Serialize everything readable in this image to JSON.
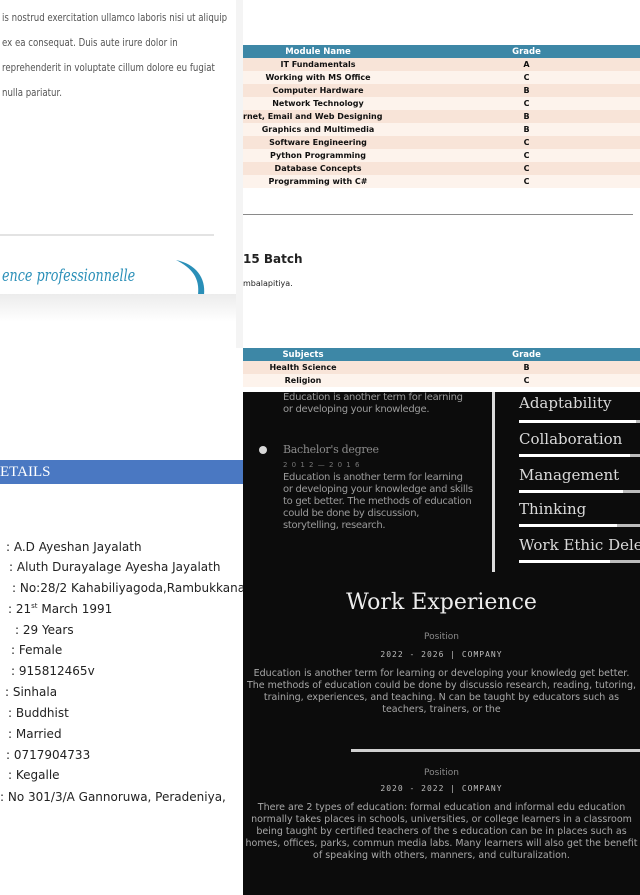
{
  "letter": {
    "paragraph": "is nostrud exercitation ullamco laboris nisi ut aliquip ex ea consequat. Duis aute irure dolor in reprehenderit in voluptate cillum dolore eu fugiat nulla pariatur.",
    "footer": "ence professionnelle"
  },
  "results_top": {
    "headers": [
      "Module Name",
      "Grade"
    ],
    "rows": [
      [
        "IT Fundamentals",
        "A"
      ],
      [
        "Working with MS Office",
        "C"
      ],
      [
        "Computer Hardware",
        "B"
      ],
      [
        "Network Technology",
        "C"
      ],
      [
        "rnet, Email and Web Designing",
        "B"
      ],
      [
        "Graphics and Multimedia",
        "B"
      ],
      [
        "Software Engineering",
        "C"
      ],
      [
        "Python Programming",
        "C"
      ],
      [
        "Database Concepts",
        "C"
      ],
      [
        "Programming with C#",
        "C"
      ]
    ],
    "batch": "15 Batch",
    "place": "mbalapitiya."
  },
  "results_bottom": {
    "headers": [
      "Subjects",
      "Grade"
    ],
    "rows": [
      [
        "Health Science",
        "B"
      ],
      [
        "Religion",
        "C"
      ]
    ]
  },
  "details": {
    "header": "ETAILS",
    "items": [
      ": A.D Ayeshan Jayalath",
      ": Aluth Durayalage Ayesha Jayalath",
      ": No:28/2 Kahabiliyagoda,Rambukkana",
      ": 21",
      ": 29 Years",
      ": Female",
      ": 915812465v",
      ": Sinhala",
      ": Buddhist",
      ": Married",
      ": 0717904733",
      ": Kegalle",
      ": No 301/3/A Gannoruwa, Peradeniya,"
    ],
    "dob_sup": "st",
    "dob_rest": " March 1991"
  },
  "cv": {
    "edu_top": "Education is another term for learning or developing your knowledge.",
    "edu_title": "Bachelor's degree",
    "edu_date": "2 0 1 2 — 2 0 1 6",
    "edu_text": "Education is another term for learning or developing your knowledge and skills to get better. The methods of education could be done by discussion, storytelling, research.",
    "skills": [
      {
        "name": "Adaptability",
        "level": 0.9
      },
      {
        "name": "Collaboration",
        "level": 0.85
      },
      {
        "name": "Management",
        "level": 0.8
      },
      {
        "name": "Thinking",
        "level": 0.75
      },
      {
        "name": "Work Ethic Dele",
        "level": 0.7
      }
    ],
    "work_title": "Work Experience",
    "jobs": [
      {
        "position": "Position",
        "meta": "2022 - 2026 | COMPANY",
        "text": "Education is another term for learning or developing your knowledg get better. The methods of education could be done by discussio research, reading, tutoring, training, experiences, and teaching. N can be taught by educators such as teachers, trainers, or the"
      },
      {
        "position": "Position",
        "meta": "2020 - 2022 | COMPANY",
        "text": "There are 2 types of education: formal education and informal edu education normally takes places in schools, universities, or college learners in a classroom being taught by certified teachers of the s education can be in places such as homes, offices, parks, commun media labs. Many learners will also get the benefit of speaking with others, manners, and culturalization."
      }
    ]
  },
  "colors": {
    "table_header": "#3d87a6",
    "details_band": "#4a78c2",
    "footer_accent": "#2a8fb8",
    "dark_bg": "#0c0c0c"
  }
}
